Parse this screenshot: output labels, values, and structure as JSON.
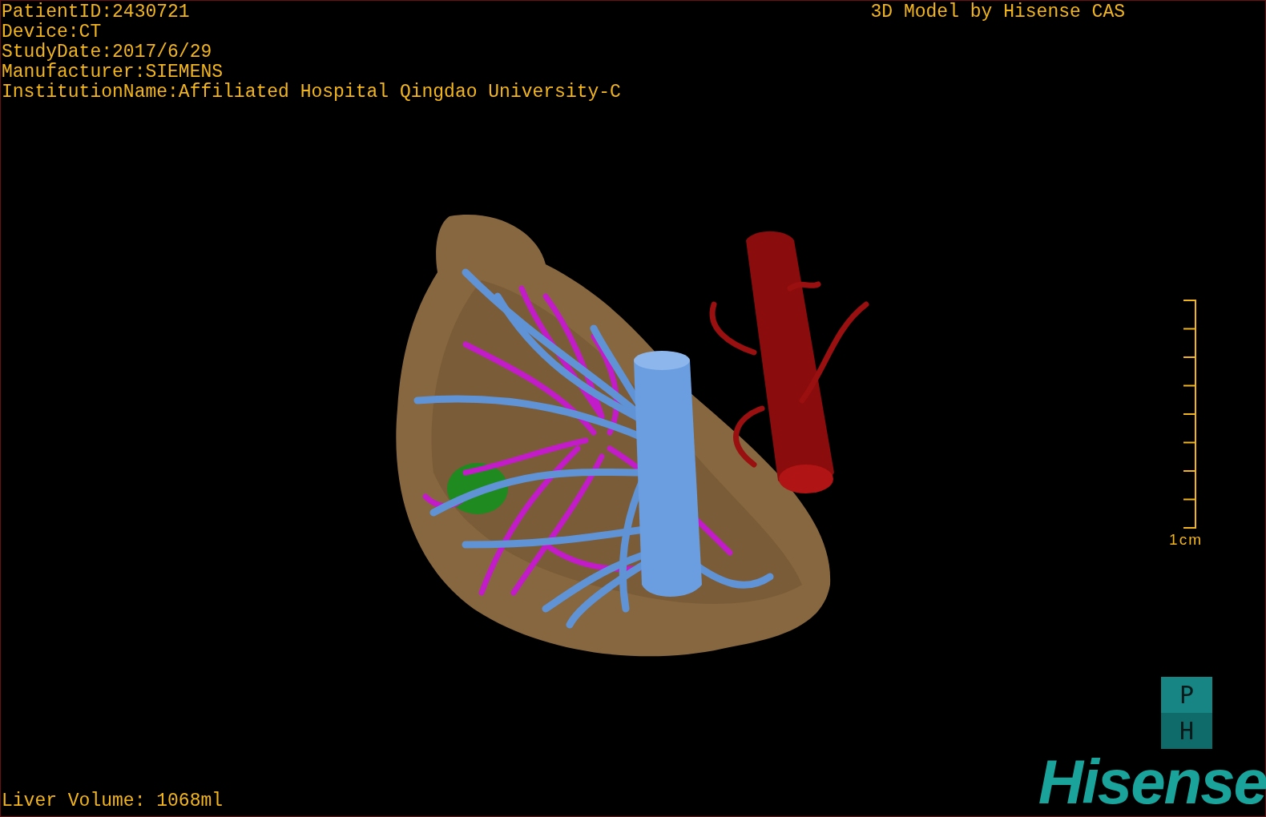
{
  "info_lines": [
    "PatientID:2430721",
    "Device:CT",
    "StudyDate:2017/6/29",
    "Manufacturer:SIEMENS",
    "InstitutionName:Affiliated Hospital Qingdao University-C"
  ],
  "title": "3D Model by Hisense CAS",
  "scale_bar": {
    "label": "1cm"
  },
  "orientation_cube": {
    "top": "P",
    "bottom": "H"
  },
  "logo": "Hisense",
  "liver_volume": "Liver Volume: 1068ml"
}
